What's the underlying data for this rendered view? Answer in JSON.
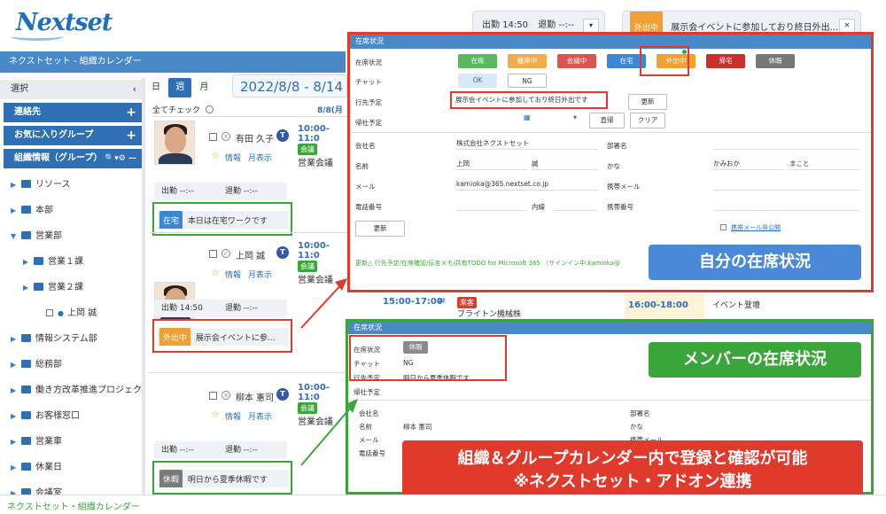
{
  "logo_text": "Nextset",
  "app_title": "ネクストセット - 組織カレンダー",
  "footer_title": "ネクストセット・組織カレンダー",
  "top_status": {
    "checkin": "出勤 14:50",
    "checkout": "退勤 --:--",
    "badge": "外出中",
    "message": "展示会イベントに参加しており終日外出..."
  },
  "sidebar": {
    "select": "選択",
    "contacts": "連絡先",
    "favorites": "お気に入りグループ",
    "org": "組織情報（グループ）",
    "items": [
      {
        "label": "リソース",
        "indent": 0
      },
      {
        "label": "本部",
        "indent": 0
      },
      {
        "label": "営業部",
        "indent": 0,
        "open": true
      },
      {
        "label": "営業１課",
        "indent": 1
      },
      {
        "label": "営業２課",
        "indent": 1
      },
      {
        "label": "上岡 誠",
        "indent": 2,
        "person": true
      },
      {
        "label": "情報システム部",
        "indent": 0
      },
      {
        "label": "総務部",
        "indent": 0
      },
      {
        "label": "働き方改革推進プロジェク",
        "indent": 0
      },
      {
        "label": "お客様窓口",
        "indent": 0
      },
      {
        "label": "営業車",
        "indent": 0
      },
      {
        "label": "休業日",
        "indent": 0
      },
      {
        "label": "会議室",
        "indent": 0
      }
    ]
  },
  "calendar": {
    "views": [
      "日",
      "週",
      "月"
    ],
    "range": "2022/8/8 - 8/14 (",
    "check_all": "全てチェック",
    "date_col": "8/8(月",
    "event_time": "10:00-11:0",
    "event_badge": "会議",
    "event_title": "営業会議",
    "extra": [
      {
        "time": "15:00-17:00",
        "badge": "来客",
        "title": "ブライトン機械株"
      },
      {
        "time": "16:00-18:00",
        "title": "イベント登壇"
      }
    ]
  },
  "members": [
    {
      "name": "有田 久子",
      "info": "情報",
      "month": "月表示",
      "checkin": "出勤 --:--",
      "checkout": "退勤 --:--",
      "status": "在宅",
      "status_color": "#3a87d6",
      "message": "本日は在宅ワークです"
    },
    {
      "name": "上岡 誠",
      "info": "情報",
      "month": "月表示",
      "checkin": "出勤 14:50",
      "checkout": "退勤 --:--",
      "status": "外出中",
      "status_color": "#f0a033",
      "message": "展示会イベントに参..."
    },
    {
      "name": "柳本 憲司",
      "info": "情報",
      "month": "月表示",
      "checkin": "出勤 --:--",
      "checkout": "退勤 --:--",
      "status": "休暇",
      "status_color": "#7a7a7a",
      "message": "明日から夏季休暇です"
    }
  ],
  "self_panel": {
    "title": "在席状況",
    "labels": {
      "status": "在席状況",
      "chat": "チャット",
      "dest": "行先予定",
      "return": "帰社予定",
      "company": "会社名",
      "dept": "部署名",
      "name": "名前",
      "kana": "かな",
      "mail": "メール",
      "mobile_mail": "携帯メール",
      "phone": "電話番号",
      "ext": "内線",
      "mobile": "携帯番号"
    },
    "status_buttons": [
      {
        "label": "在席",
        "color": "#5cb85c"
      },
      {
        "label": "離席中",
        "color": "#f0ad4e"
      },
      {
        "label": "会議中",
        "color": "#d9534f"
      },
      {
        "label": "在宅",
        "color": "#3a87d6"
      },
      {
        "label": "外出中",
        "color": "#f0a033"
      },
      {
        "label": "帰宅",
        "color": "#c9302c"
      },
      {
        "label": "休暇",
        "color": "#777777"
      }
    ],
    "chat_ok": "OK",
    "chat_ng": "NG",
    "dest_value": "展示会イベントに参加しており終日外出です",
    "update": "更新",
    "direct_return": "直帰",
    "clear": "クリア",
    "company": "株式会社ネクストセット",
    "last": "上岡",
    "first": "誠",
    "kana_last": "かみおか",
    "kana_first": "まこと",
    "mail": "kamioka@365.nextset.co.jp",
    "hide_mobile": "携帯メール非公開",
    "footer_note": "更新△ 行先予定/在席確認/伝言メモ/共有TODO for Microsoft 365 （サインイン中:kamioka@"
  },
  "member_panel": {
    "title": "在席状況",
    "labels": {
      "status": "在席状況",
      "chat": "チャット",
      "dest": "行先予定",
      "return": "帰社予定",
      "company": "会社名",
      "dept": "部署名",
      "name": "名前",
      "kana": "かな",
      "mail": "メール",
      "mobile_mail": "携帯メール",
      "phone": "電話番号"
    },
    "status": "休暇",
    "chat": "NG",
    "dest": "明日から夏季休暇です",
    "name": "柳本 憲司"
  },
  "callouts": {
    "self": "自分の在席状況",
    "member": "メンバーの在席状況",
    "main_line1": "組織＆グループカレンダー内で登録と確認が可能",
    "main_line2": "※ネクストセット・アドオン連携"
  },
  "colors": {
    "accent": "#2f6fb3",
    "red": "#e03a2c",
    "green": "#3aa63a"
  }
}
